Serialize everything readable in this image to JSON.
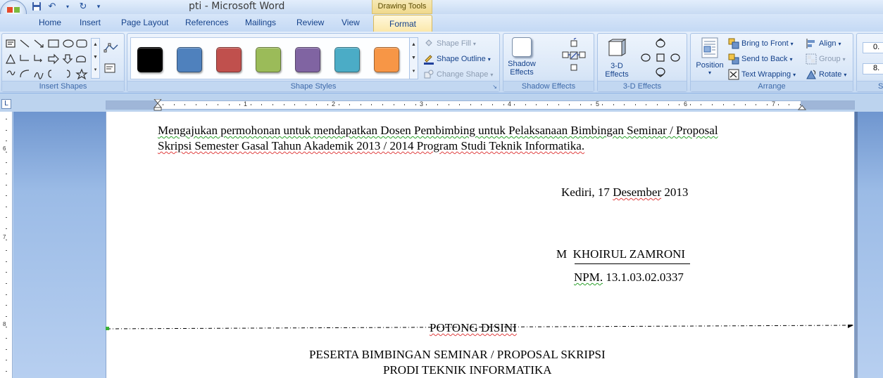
{
  "window": {
    "title": "pti - Microsoft Word",
    "contextual_tab_header": "Drawing Tools"
  },
  "quick_access": {
    "icons": [
      "save-icon",
      "undo-icon",
      "redo-icon",
      "customize-icon"
    ]
  },
  "tabs": [
    {
      "label": "Home"
    },
    {
      "label": "Insert"
    },
    {
      "label": "Page Layout"
    },
    {
      "label": "References"
    },
    {
      "label": "Mailings"
    },
    {
      "label": "Review"
    },
    {
      "label": "View"
    },
    {
      "label": "Format",
      "active": true
    }
  ],
  "ribbon": {
    "insert_shapes": {
      "label": "Insert Shapes"
    },
    "shape_styles": {
      "label": "Shape Styles",
      "swatches": [
        "#000000",
        "#4f81bd",
        "#c0504d",
        "#9bbb59",
        "#8064a2",
        "#4bacc6",
        "#f79646"
      ],
      "shape_fill": "Shape Fill",
      "shape_outline": "Shape Outline",
      "change_shape": "Change Shape"
    },
    "shadow_effects": {
      "label": "Shadow Effects",
      "button": "Shadow Effects"
    },
    "three_d_effects": {
      "label": "3-D Effects",
      "button": "3-D Effects"
    },
    "arrange": {
      "label": "Arrange",
      "position": "Position",
      "bring_to_front": "Bring to Front",
      "send_to_back": "Send to Back",
      "text_wrapping": "Text Wrapping",
      "align": "Align",
      "group": "Group",
      "rotate": "Rotate"
    },
    "size": {
      "label": "S",
      "height": "0.",
      "width": "8."
    }
  },
  "ruler": {
    "numbers": [
      "1",
      "2",
      "3",
      "4",
      "5",
      "6",
      "7"
    ],
    "vertical_numbers": [
      "6",
      "7",
      "8"
    ]
  },
  "document": {
    "para_line1": "Mengajukan permohonan untuk mendapatkan Dosen Pembimbing untuk Pelaksanaan Bimbingan Seminar / Proposal",
    "para_line2": "Skripsi Semester Gasal Tahun Akademik 2013 / 2014 Program Studi Teknik Informatika.",
    "date_city": "Kediri, 17",
    "date_month": "Desember",
    "date_year": "2013",
    "name_prefix": "M",
    "name": "KHOIRUL ZAMRONI",
    "npm_label": "NPM.",
    "npm_value": "13.1.03.02.0337",
    "cut_label": "POTONG DISINI",
    "heading1": "PESERTA BIMBINGAN SEMINAR / PROPOSAL SKRIPSI",
    "heading2": "PRODI TEKNIK INFORMATIKA"
  }
}
